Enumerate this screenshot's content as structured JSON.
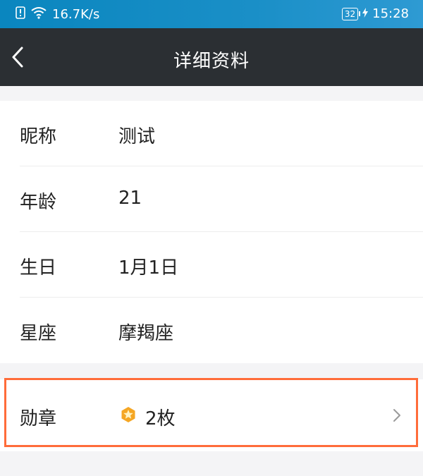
{
  "status_bar": {
    "speed": "16.7K/s",
    "battery": "32",
    "time": "15:28"
  },
  "header": {
    "title": "详细资料"
  },
  "profile": [
    {
      "label": "昵称",
      "value": "测试"
    },
    {
      "label": "年龄",
      "value": "21"
    },
    {
      "label": "生日",
      "value": "1月1日"
    },
    {
      "label": "星座",
      "value": "摩羯座"
    }
  ],
  "badges": {
    "label": "勋章",
    "value": "2枚"
  },
  "colors": {
    "status_bar": "#0a86bf",
    "nav_bar": "#2b2f33",
    "highlight": "#ff6c3a",
    "medal": "#f5a623"
  }
}
